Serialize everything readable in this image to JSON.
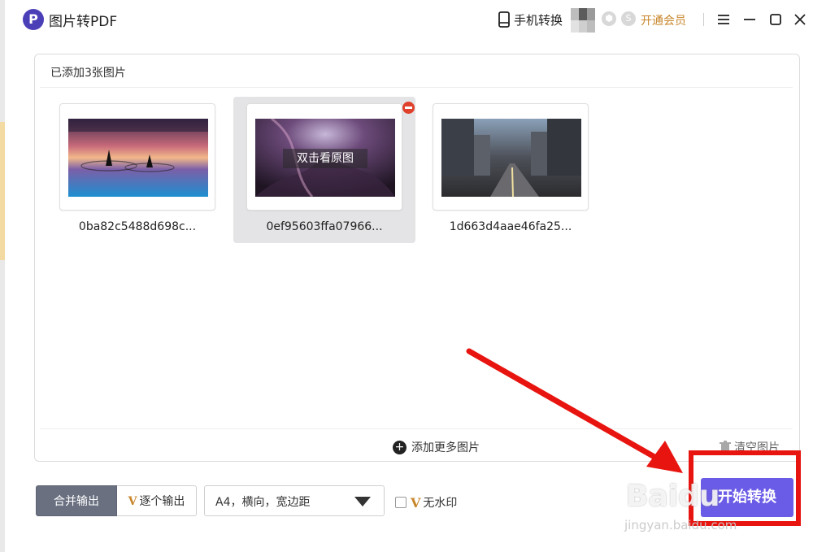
{
  "app": {
    "logo_letter": "P",
    "title": "图片转PDF"
  },
  "titlebar": {
    "mobile_convert": "手机转换",
    "vip_label": "开通会员",
    "badge_1": "",
    "badge_2": "S",
    "icons": [
      "phone-icon",
      "menu-icon",
      "minimize-icon",
      "maximize-icon",
      "close-icon"
    ]
  },
  "panel": {
    "header": "已添加3张图片",
    "images": [
      {
        "name": "0ba82c5488d698c...",
        "selected": false
      },
      {
        "name": "0ef95603ffa07966...",
        "selected": true,
        "hint": "双击看原图"
      },
      {
        "name": "1d663d4aae46fa25...",
        "selected": false
      }
    ],
    "add_more": "添加更多图片",
    "clear": "清空图片"
  },
  "bottom": {
    "merge_output": "合并输出",
    "vip_mark": "V",
    "each_output": "逐个输出",
    "page_setting": "A4，横向，宽边距",
    "no_watermark": "无水印",
    "start_convert": "开始转换"
  },
  "watermark": {
    "text": "Baidu",
    "sub": "jingyan.baidu.com"
  },
  "colors": {
    "brand": "#4b3fb8",
    "convert_button": "#6b5ce7",
    "vip": "#c8862a",
    "annotation": "#e8140f"
  }
}
